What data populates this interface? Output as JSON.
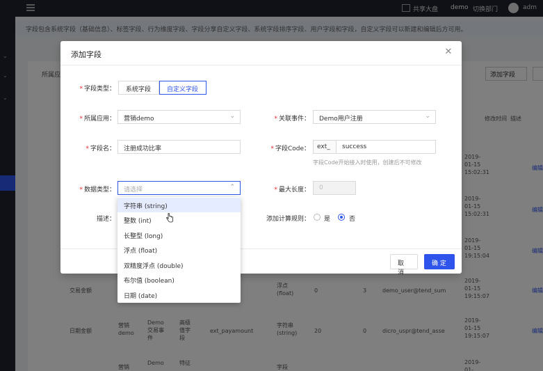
{
  "topbar": {
    "t1": "共享大盘",
    "t2": "demo",
    "t3": "切换部门",
    "user": "adm"
  },
  "notice": "字段包含系统字段（基础信息）、标签字段、行为维度字段、字段分享自定义字段、系统字段排序字段、用户字段和字段，自定义字段可以新建和编辑后方可用。",
  "background": {
    "toolbar_label": "所属应",
    "add_btn": "添加字段",
    "col_headers": [
      "修改时间",
      "描述"
    ],
    "times": [
      "2019-01-15 15:02:31",
      "2019-01-15 15:02:31",
      "2019-01-15 19:15:04",
      "2019-01-15 19:15:07",
      "2019-01-15 19:15:07",
      "2019-01-"
    ],
    "row_links": [
      "编辑",
      "编辑",
      "编辑",
      "编辑",
      "编辑"
    ],
    "row_a": [
      "交易金额",
      "浮点(float)",
      "0",
      "3",
      "demo_user@tend_sum"
    ],
    "row_b": [
      "日期金额",
      "营销demo",
      "Demo交易事件",
      "高级值字段",
      "ext_payamount",
      "字符串(string)",
      "20",
      "0",
      "dicro_uspr@tend_asse"
    ],
    "row_c": [
      "营销",
      "Demo",
      "特征",
      "字段"
    ]
  },
  "modal": {
    "title": "添加字段",
    "field_type": {
      "label": "字段类型：",
      "options": [
        "系统字段",
        "自定义字段"
      ],
      "selected": 1
    },
    "app": {
      "label": "所属应用：",
      "value": "营销demo"
    },
    "event": {
      "label": "关联事件：",
      "value": "Demo用户注册"
    },
    "name": {
      "label": "字段名：",
      "value": "注册成功比率"
    },
    "code": {
      "label": "字段Code：",
      "prefix": "ext_",
      "value": "success",
      "hint": "字段Code开始接入时使用，创建后不可修改"
    },
    "data_type": {
      "label": "数据类型：",
      "placeholder": "请选择"
    },
    "max_len": {
      "label": "最大长度：",
      "placeholder": "0"
    },
    "desc": {
      "label": "描述："
    },
    "calc_rule": {
      "label": "添加计算规则：",
      "yes": "是",
      "no": "否",
      "selected": "no"
    },
    "cancel": "取 消",
    "ok": "确 定"
  },
  "dropdown": {
    "options": [
      "字符串 (string)",
      "整数 (int)",
      "长整型 (long)",
      "浮点 (float)",
      "双精度浮点 (double)",
      "布尔值 (boolean)",
      "日期 (date)"
    ],
    "hovered": 0
  },
  "colors": {
    "primary": "#2f54eb",
    "required": "#f5222d"
  }
}
